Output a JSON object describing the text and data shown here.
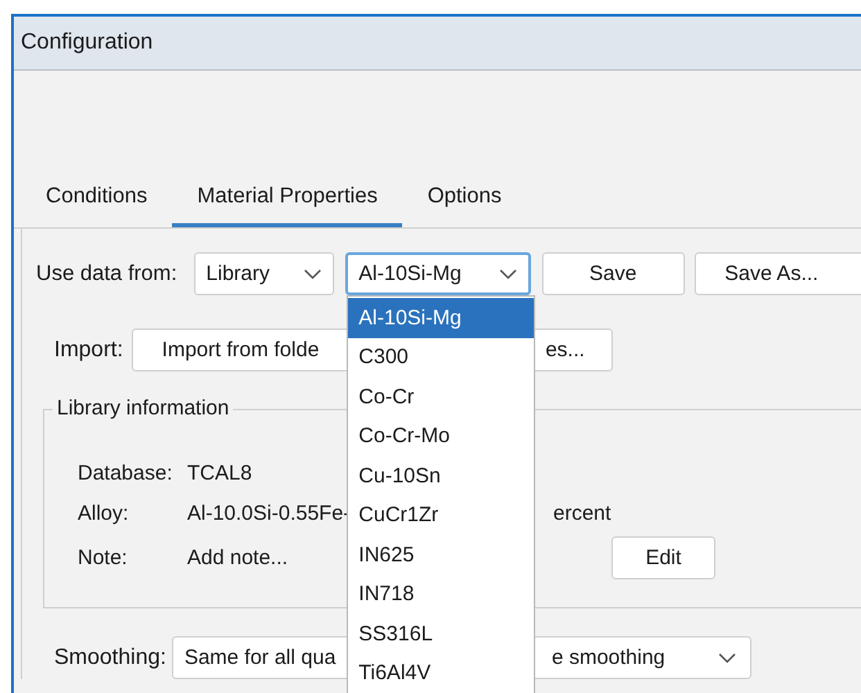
{
  "window": {
    "title": "Configuration"
  },
  "tabs": [
    {
      "label": "Conditions",
      "selected": false
    },
    {
      "label": "Material Properties",
      "selected": true
    },
    {
      "label": "Options",
      "selected": false
    }
  ],
  "data_source": {
    "label": "Use data from:",
    "source": "Library",
    "material": "Al-10Si-Mg",
    "material_open": true
  },
  "material_options": [
    {
      "label": "Al-10Si-Mg",
      "selected": true
    },
    {
      "label": "C300",
      "selected": false
    },
    {
      "label": "Co-Cr",
      "selected": false
    },
    {
      "label": "Co-Cr-Mo",
      "selected": false
    },
    {
      "label": "Cu-10Sn",
      "selected": false
    },
    {
      "label": "CuCr1Zr",
      "selected": false
    },
    {
      "label": "IN625",
      "selected": false
    },
    {
      "label": "IN718",
      "selected": false
    },
    {
      "label": "SS316L",
      "selected": false
    },
    {
      "label": "Ti6Al4V",
      "selected": false
    }
  ],
  "buttons": [
    "Save",
    "Save As..."
  ],
  "import": {
    "label": "Import:",
    "button_left": "Import from folde",
    "button_right": "es..."
  },
  "library_info": {
    "title": "Library information",
    "rows": [
      {
        "label": "Database:",
        "value": "TCAL8"
      },
      {
        "label": "Alloy:",
        "value": "Al-10.0Si-0.55Fe-",
        "value_right": "ercent"
      },
      {
        "label": "Note:",
        "value": "Add note..."
      }
    ],
    "edit_button": "Edit"
  },
  "smoothing": {
    "label": "Smoothing:",
    "value_left": "Same for all qua",
    "value_right": "e smoothing"
  }
}
